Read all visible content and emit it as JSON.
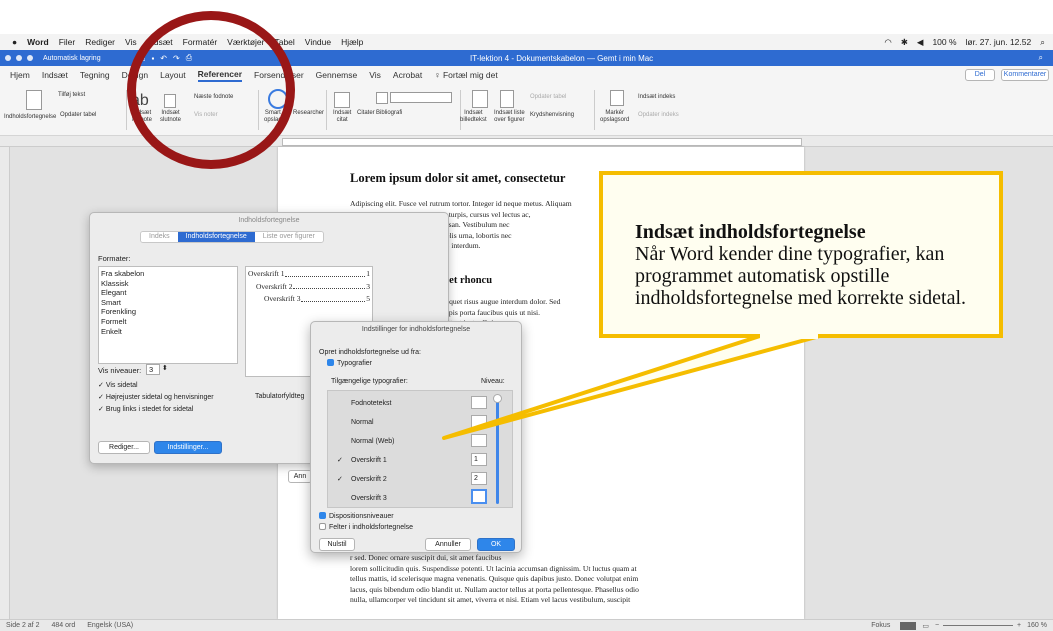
{
  "menubar": {
    "items": [
      "Word",
      "Filer",
      "Rediger",
      "Vis",
      "Indsæt",
      "Formatér",
      "Værktøjer",
      "Tabel",
      "Vindue",
      "Hjælp"
    ],
    "right": {
      "battery": "100 %",
      "datetime": "lør. 27. jun.  12.52"
    }
  },
  "titlebar": {
    "autosave": "Automatisk lagring",
    "title": "IT-lektion 4 - Dokumentskabelon — Gemt i min Mac"
  },
  "ribbon_tabs": [
    "Hjem",
    "Indsæt",
    "Tegning",
    "Design",
    "Layout",
    "Referencer",
    "Forsendelser",
    "Gennemse",
    "Vis",
    "Acrobat",
    "Fortæl mig det"
  ],
  "ribbon_right": {
    "share": "Del",
    "comments": "Kommentarer"
  },
  "ribbon": {
    "toc": "Indholdsfortegnelse",
    "add_text": "Tilføj tekst",
    "update_table": "Opdater tabel",
    "insert_footnote": "Indsæt\nfodnote",
    "insert_endnote": "Indsæt\nslutnote",
    "next_footnote": "Næste fodnote",
    "show_notes": "Vis noter",
    "smart_lookup": "Smart\nopslag",
    "researcher": "Researcher",
    "insert_citation": "Indsæt\ncitat",
    "citations": "Citater",
    "bibliography": "Bibliografi",
    "insert_caption": "Indsæt\nbilledtekst",
    "insert_tof": "Indsæt liste\nover figurer",
    "cross_reference": "Krydshenvisning",
    "update_table2": "Opdater tabel",
    "mark_entry": "Markér\nopslagsord",
    "insert_index": "Indsæt indeks",
    "update_index": "Opdater indeks"
  },
  "document": {
    "heading1": "Lorem ipsum dolor sit amet, consectetur",
    "para1": [
      "Adipiscing elit. Fusce vel rutrum tortor. Integer id neque metus. Aliquam",
      "arcu non porttitor. Mauris tortor turpis, cursus vel lectus ac,",
      "hendrerit libero ac ornare accumsan. Vestibulum nec",
      ". Aliquam et ornare urna. Cras felis urna, lobortis nec",
      "esent varius arcu et eros ultricies interdum."
    ],
    "heading2": "llentesque, odio sit amet rhoncu",
    "para2": [
      "metus felis molestie lectus, at aliquet risus augue interdum dolor. Sed",
      "ula. Etiam vel ipsum sit amet turpis porta faucibus quis ut nisi.",
      "isus laoreet, rutrum tortor a, volutpat justo. Quisque",
      "rper non pellentesque sodales.",
      "d ex eleifend, nec maximus nisl diam.",
      "volutpat dolor, ut iaculis augue."
    ],
    "para3": [
      "euismod turpis lacinia sit amet. Nam ultricies",
      "tesque iaculis. Sed ultrices congue felis. Vivamus",
      "tibulum tincidunt non neque, ullamcorper",
      "itudin lacinia. Aenean dapibus nisi vel elit congue,",
      "m orci. Vestibulum ante ipsum primis in faucibus",
      "Nulla sed aliquet leo. Quisque maximus mauris",
      "Nullam porta enim ante. Quisque ac nisi sed felis",
      "a ac, mattis dapibus erat. Morbi hendrerit luctus",
      "odo, mauris eu tincidunt viverra, justo arcu varius",
      "in maximus dolor. Sed pulvinar augue non risus",
      "t ac vestibulum mi. Vivamus tincidunt venenatis",
      "ttitor, nec fermentum tortor lobortis. Ut quis",
      "is. Fusce a lectus dapibus, scelerisque sem a,",
      "is. Fusce sagittis vel quam et bibendum."
    ],
    "para4": [
      "r sed. Donec ornare suscipit dui, sit amet faucibus",
      "lorem sollicitudin quis. Suspendisse potenti. Ut lacinia accumsan dignissim. Ut luctus quam at",
      "tellus mattis, id scelerisque magna venenatis. Quisque quis dapibus justo. Donec volutpat enim",
      "lacus, quis bibendum odio blandit ut. Nullam auctor tellus at porta pellentesque. Phasellus odio",
      "nulla, ullamcorper vel tincidunt sit amet, viverra et nisi. Etiam vel lacus vestibulum, suscipit"
    ]
  },
  "toc_dialog": {
    "title": "Indholdsfortegnelse",
    "tabs": [
      "Indeks",
      "Indholdsfortegnelse",
      "Liste over figurer"
    ],
    "formats_label": "Formater:",
    "formats": [
      "Fra skabelon",
      "Klassisk",
      "Elegant",
      "Smart",
      "Forenkling",
      "Formelt",
      "Enkelt"
    ],
    "preview": [
      {
        "label": "Overskrift 1",
        "page": "1"
      },
      {
        "label": "Overskrift 2",
        "page": "3"
      },
      {
        "label": "Overskrift 3",
        "page": "5"
      }
    ],
    "levels_label": "Vis niveauer:",
    "levels_value": "3",
    "options": [
      "Vis sidetal",
      "Højrejuster sidetal og henvisninger",
      "Brug links i stedet for sidetal"
    ],
    "tab_leader_label": "Tabulatorfyldteg",
    "edit_button": "Rediger...",
    "settings_button": "Indstillinger...",
    "cancel_partial": "Ann"
  },
  "settings_dialog": {
    "title": "Indstillinger for indholdsfortegnelse",
    "build_from": "Opret indholdsfortegnelse ud fra:",
    "styles_check": "Typografier",
    "available_label": "Tilgængelige typografier:",
    "level_label": "Niveau:",
    "styles": [
      {
        "name": "Fodnotetekst",
        "level": "",
        "checked": false
      },
      {
        "name": "Normal",
        "level": "",
        "checked": false
      },
      {
        "name": "Normal (Web)",
        "level": "",
        "checked": false
      },
      {
        "name": "Overskrift 1",
        "level": "1",
        "checked": true
      },
      {
        "name": "Overskrift 2",
        "level": "2",
        "checked": true
      },
      {
        "name": "Overskrift 3",
        "level": "",
        "checked": false
      }
    ],
    "outline_levels": "Dispositionsniveauer",
    "toc_fields": "Felter i indholdsfortegnelse",
    "reset_button": "Nulstil",
    "cancel_button": "Annuller",
    "ok_button": "OK"
  },
  "callout": {
    "title": "Indsæt indholdsfortegnelse",
    "body": "Når Word kender dine typografier, kan programmet automatisk opstille indholdsfortegnelse med korrekte sidetal."
  },
  "statusbar": {
    "page": "Side 2 af 2",
    "words": "484 ord",
    "language": "Engelsk (USA)",
    "focus": "Fokus",
    "zoom": "160 %"
  },
  "colors": {
    "accent": "#2e6bd1",
    "callout_border": "#f5bd00",
    "circle": "#991717"
  }
}
